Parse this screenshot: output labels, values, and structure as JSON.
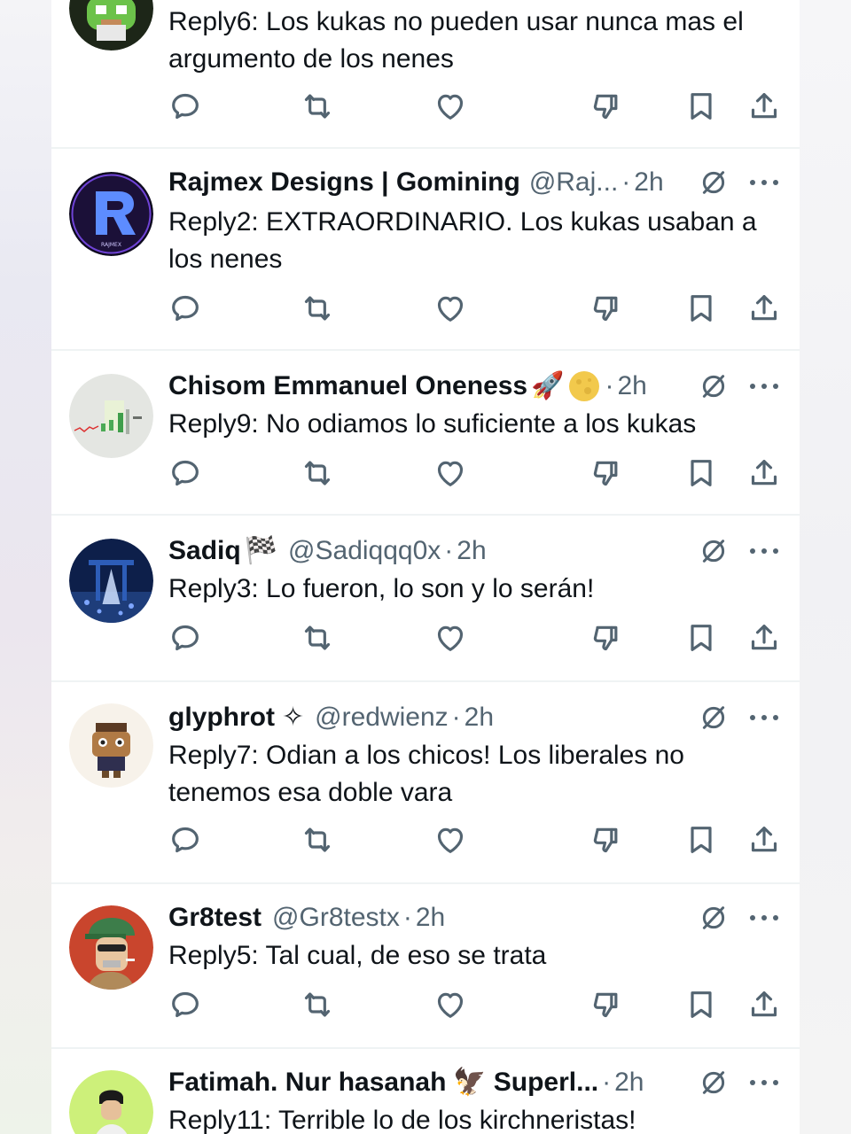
{
  "colors": {
    "text": "#0f1419",
    "secondary": "#536471",
    "divider": "#eff3f4",
    "background": "#ffffff"
  },
  "icons": [
    "reply-icon",
    "retweet-icon",
    "like-icon",
    "downvote-icon",
    "bookmark-icon",
    "share-icon",
    "grok-icon",
    "more-icon"
  ],
  "replies": [
    {
      "text": "Reply6: Los kukas no pueden usar nunca mas el argumento de los nenes"
    },
    {
      "name": "Rajmex Designs | Gomining",
      "handle": "@Raj...",
      "dot": "·",
      "time": "2h",
      "text": "Reply2: EXTRAORDINARIO. Los kukas usaban a los nenes",
      "avatar_text": "RAJMEX"
    },
    {
      "name": "Chisom Emmanuel Oneness",
      "emoji": "🚀",
      "handle": "",
      "dot": "·",
      "time": "2h",
      "text": "Reply9: No odiamos lo suficiente a los kukas"
    },
    {
      "name": "Sadiq",
      "emoji": "🏁",
      "handle": "@Sadiqqq0x",
      "dot": "·",
      "time": "2h",
      "text": "Reply3: Lo fueron, lo son y lo serán!"
    },
    {
      "name": "glyphrot",
      "emoji": "✧",
      "handle": "@redwienz",
      "dot": "·",
      "time": "2h",
      "text": "Reply7: Odian a los chicos! Los liberales no tenemos esa doble vara"
    },
    {
      "name": "Gr8test",
      "handle": "@Gr8testx",
      "dot": "·",
      "time": "2h",
      "text": "Reply5: Tal cual, de eso se trata"
    },
    {
      "name": "Fatimah. Nur hasanah",
      "emoji": "🦅",
      "handle": "Superl...",
      "dot": "·",
      "time": "2h",
      "text": "Reply11: Terrible lo de los kirchneristas!"
    }
  ]
}
